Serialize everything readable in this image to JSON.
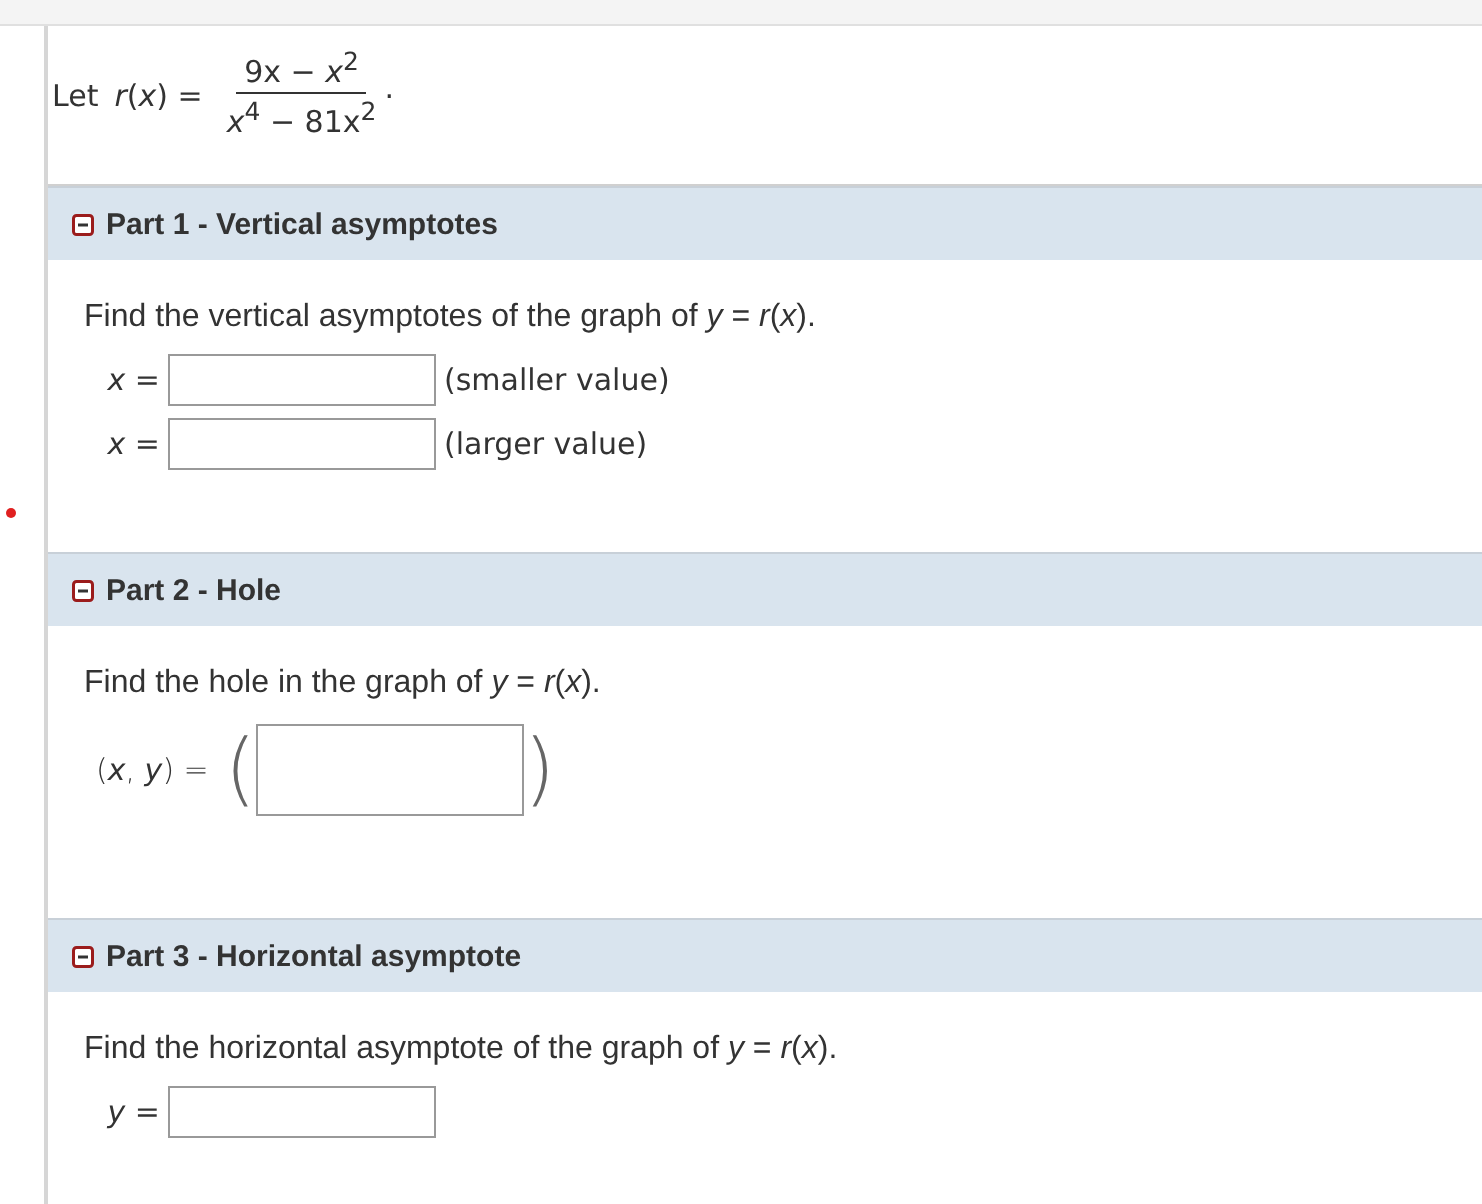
{
  "intro": {
    "lead": "Let",
    "lhs": "*r*(*x*) =",
    "numerator": "9x − *x*$^{2}$",
    "denominator": "*x*$^{4}$ − 81x$^{2}$",
    "end": "."
  },
  "parts": [
    {
      "title": "Part 1 - Vertical asymptotes",
      "expanded": true,
      "prompt": "Find the vertical asymptotes of the graph of  *y* = *r*(*x*).",
      "answers": [
        {
          "kind": "plain",
          "label": "*x* =",
          "note": "(smaller value)"
        },
        {
          "kind": "plain",
          "label": "*x* =",
          "note": "(larger value)"
        }
      ]
    },
    {
      "title": "Part 2 - Hole",
      "expanded": true,
      "prompt": "Find the hole in the graph of  *y* = *r*(*x*).",
      "answers": [
        {
          "kind": "paren",
          "label": "(*x*, *y*) =",
          "open": "(",
          "close": ")"
        }
      ]
    },
    {
      "title": "Part 3 - Horizontal asymptote",
      "expanded": true,
      "prompt": "Find the horizontal asymptote of the graph of  *y* = *r*(*x*).",
      "answers": [
        {
          "kind": "plain",
          "label": "*y* ="
        }
      ]
    }
  ]
}
